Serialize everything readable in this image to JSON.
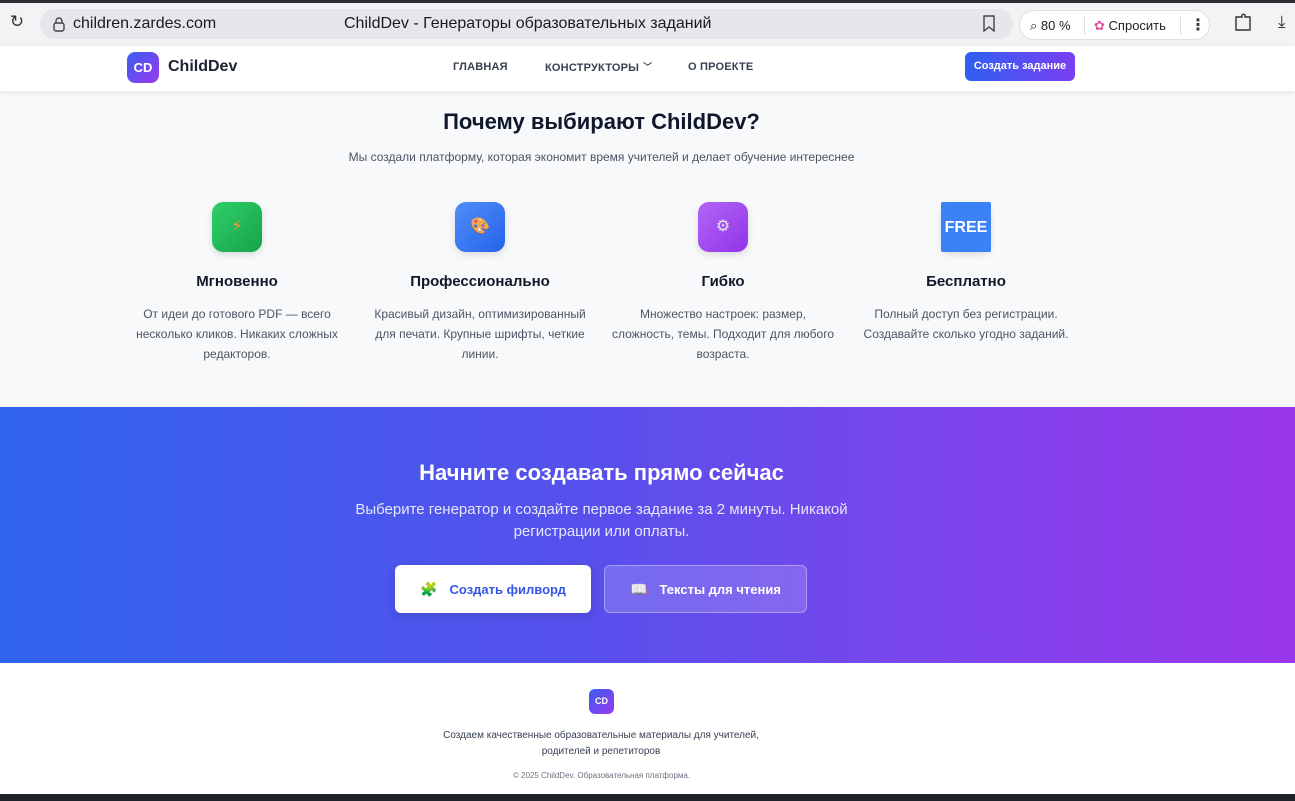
{
  "browser": {
    "url": "children.zardes.com",
    "page_title": "ChildDev - Генераторы образовательных заданий",
    "zoom": "80 %",
    "ask_label": "Спросить",
    "icons": [
      "reload-icon",
      "lock-icon",
      "bookmark-icon",
      "zoom-icon",
      "ask-sparkle-icon",
      "more-icon",
      "extensions-icon",
      "download-icon"
    ]
  },
  "header": {
    "logo_badge": "CD",
    "logo_text": "ChildDev",
    "nav": {
      "home": "ГЛАВНАЯ",
      "builders": "КОНСТРУКТОРЫ",
      "about": "О ПРОЕКТЕ"
    },
    "cta": "Создать задание"
  },
  "features": {
    "title": "Почему выбирают ChildDev?",
    "subtitle": "Мы создали платформу, которая экономит время учителей и делает обучение интереснее",
    "items": [
      {
        "icon": "lightning-icon",
        "glyph": "⚡",
        "color": "#22c55e",
        "title": "Мгновенно",
        "text": "От идеи до готового PDF — всего несколько кликов. Никаких сложных редакторов."
      },
      {
        "icon": "palette-icon",
        "glyph": "🎨",
        "color": "#3b82f6",
        "title": "Профессионально",
        "text": "Красивый дизайн, оптимизированный для печати. Крупные шрифты, четкие линии."
      },
      {
        "icon": "gear-icon",
        "glyph": "⚙",
        "color": "#a855f7",
        "title": "Гибко",
        "text": "Множество настроек: размер, сложность, темы. Подходит для любого возраста."
      },
      {
        "icon": "free-icon",
        "glyph": "FREE",
        "color": "#ef4444",
        "title": "Бесплатно",
        "text": "Полный доступ без регистрации. Создавайте сколько угодно заданий."
      }
    ]
  },
  "cta_section": {
    "title": "Начните создавать прямо сейчас",
    "subtitle": "Выберите генератор и создайте первое задание за 2 минуты. Никакой регистрации или оплаты.",
    "primary_button": "Создать филворд",
    "primary_glyph": "🧩",
    "secondary_button": "Тексты для чтения",
    "secondary_glyph": "📖"
  },
  "footer": {
    "logo_badge": "CD",
    "description": "Создаем качественные образовательные материалы для учителей, родителей и репетиторов",
    "copyright": "© 2025 ChildDev. Образовательная платформа."
  }
}
